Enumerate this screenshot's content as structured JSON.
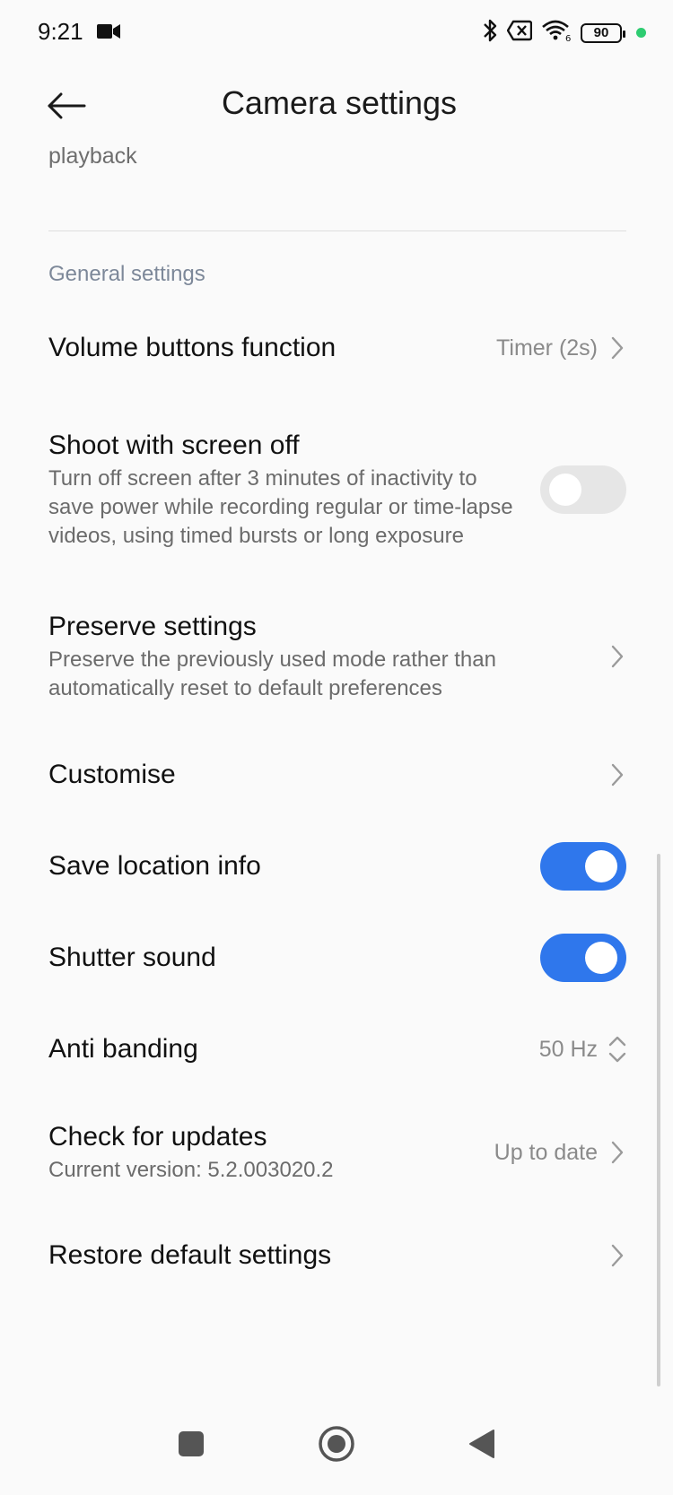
{
  "status_bar": {
    "time": "9:21",
    "battery": "90",
    "icons": [
      "video-camera-icon",
      "bluetooth-icon",
      "no-sim-icon",
      "wifi-icon",
      "battery-icon"
    ],
    "dot_color": "#2ecc71"
  },
  "header": {
    "title": "Camera settings",
    "back_icon": "arrow-left-icon"
  },
  "partial_item": {
    "text": "playback"
  },
  "section": {
    "title": "General settings"
  },
  "items": [
    {
      "title": "Volume buttons function",
      "value": "Timer (2s)",
      "control": "chevron"
    },
    {
      "title": "Shoot with screen off",
      "subtitle": "Turn off screen after 3 minutes of inactivity to save power while recording regular or time-lapse videos, using timed bursts or long exposure",
      "control": "toggle",
      "state": "off"
    },
    {
      "title": "Preserve settings",
      "subtitle": "Preserve the previously used mode rather than automatically reset to default preferences",
      "control": "chevron"
    },
    {
      "title": "Customise",
      "control": "chevron"
    },
    {
      "title": "Save location info",
      "control": "toggle",
      "state": "on"
    },
    {
      "title": "Shutter sound",
      "control": "toggle",
      "state": "on"
    },
    {
      "title": "Anti banding",
      "value": "50 Hz",
      "control": "updown"
    },
    {
      "title": "Check for updates",
      "subtitle": "Current version: 5.2.003020.2",
      "value": "Up to date",
      "control": "chevron"
    },
    {
      "title": "Restore default settings",
      "control": "chevron"
    }
  ],
  "colors": {
    "accent": "#2f77ec",
    "toggle_off": "#e6e6e6",
    "section_title": "#7d8899"
  },
  "nav_bar": {
    "icons": [
      "recents-square-icon",
      "home-circle-icon",
      "back-triangle-icon"
    ]
  }
}
